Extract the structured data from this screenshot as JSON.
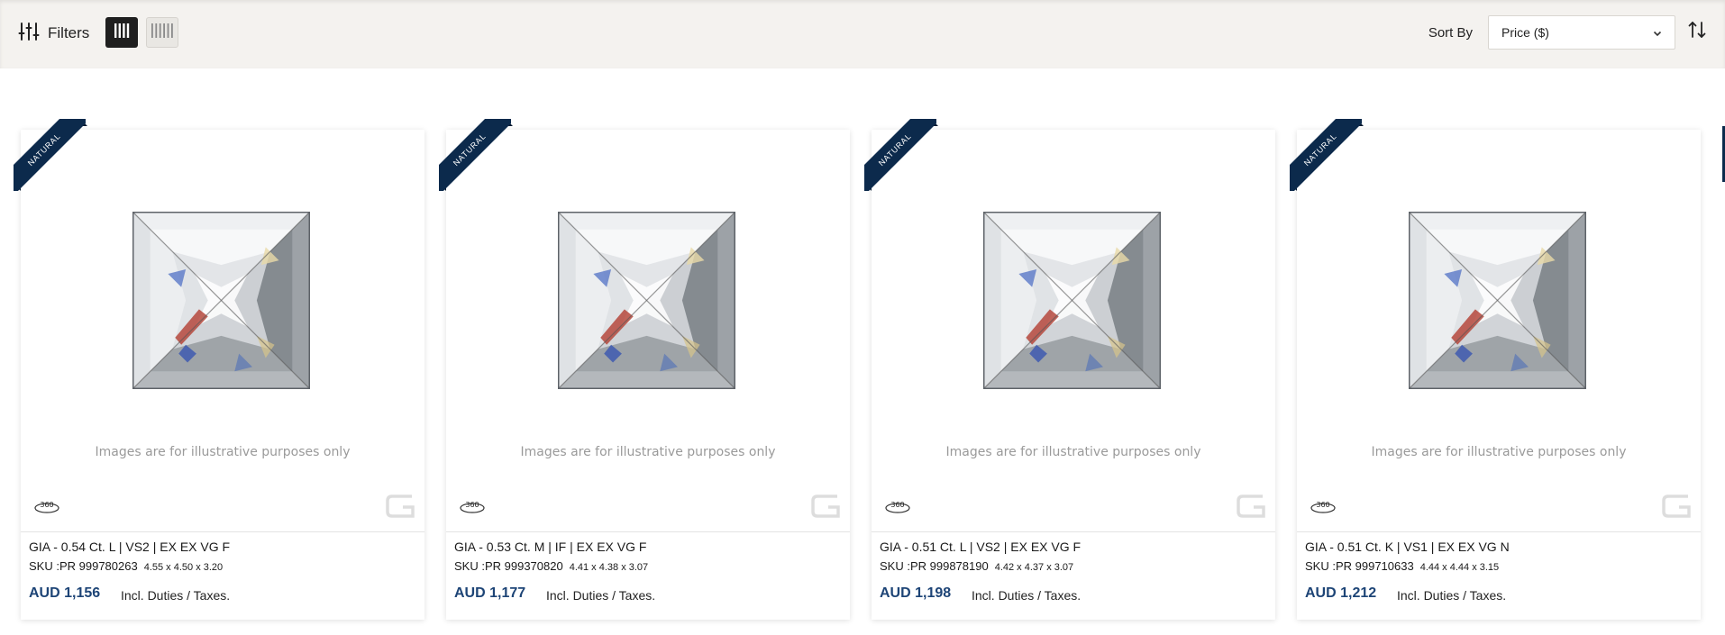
{
  "toolbar": {
    "filters_label": "Filters",
    "sort_label": "Sort By",
    "sort_value": "Price ($)"
  },
  "products": [
    {
      "ribbon": "NATURAL",
      "title": "GIA - 0.54 Ct. L | VS2 | EX EX VG F",
      "sku": "SKU :PR 999780263",
      "dims": "4.55 x 4.50 x 3.20",
      "price": "AUD 1,156",
      "duties": "Incl. Duties / Taxes.",
      "disclaimer": "Images are for illustrative purposes only",
      "badge_360": "360"
    },
    {
      "ribbon": "NATURAL",
      "title": "GIA - 0.53 Ct. M | IF | EX EX VG F",
      "sku": "SKU :PR 999370820",
      "dims": "4.41 x 4.38 x 3.07",
      "price": "AUD 1,177",
      "duties": "Incl. Duties / Taxes.",
      "disclaimer": "Images are for illustrative purposes only",
      "badge_360": "360"
    },
    {
      "ribbon": "NATURAL",
      "title": "GIA - 0.51 Ct. L | VS2 | EX EX VG F",
      "sku": "SKU :PR 999878190",
      "dims": "4.42 x 4.37 x 3.07",
      "price": "AUD 1,198",
      "duties": "Incl. Duties / Taxes.",
      "disclaimer": "Images are for illustrative purposes only",
      "badge_360": "360"
    },
    {
      "ribbon": "NATURAL",
      "title": "GIA - 0.51 Ct. K | VS1 | EX EX VG N",
      "sku": "SKU :PR 999710633",
      "dims": "4.44 x 4.44 x 3.15",
      "price": "AUD 1,212",
      "duties": "Incl. Duties / Taxes.",
      "disclaimer": "Images are for illustrative purposes only",
      "badge_360": "360"
    }
  ],
  "colors": {
    "brand_navy": "#0c2a4c",
    "price_blue": "#1d4476",
    "toolbar_bg": "#f4f2ef"
  }
}
